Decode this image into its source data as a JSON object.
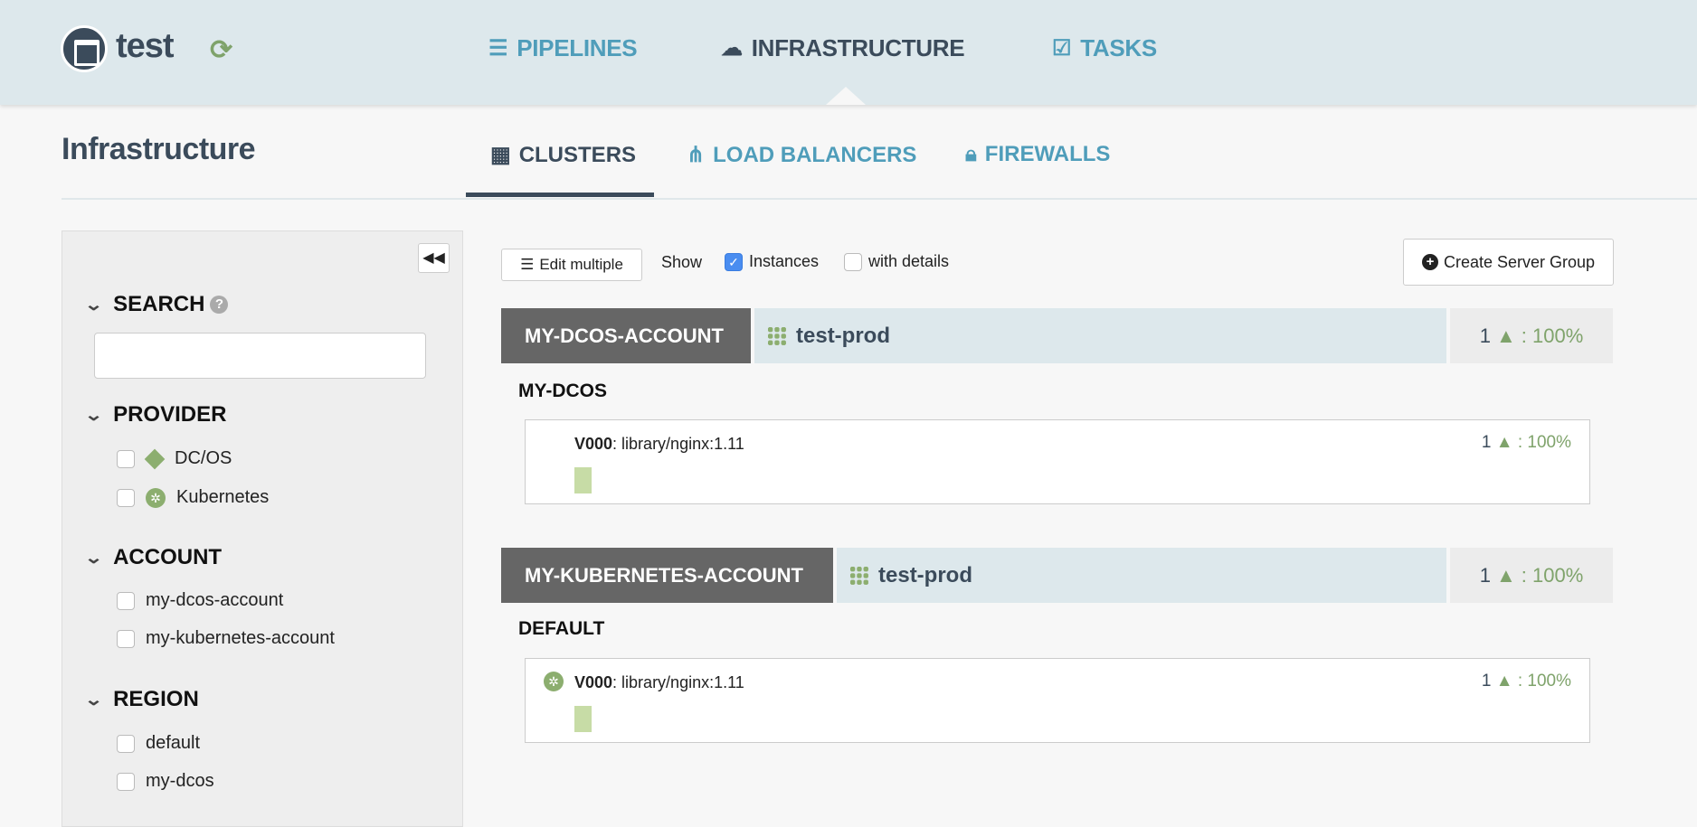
{
  "header": {
    "app_title": "test",
    "nav": [
      {
        "label": "PIPELINES",
        "icon": "list-icon",
        "active": false
      },
      {
        "label": "INFRASTRUCTURE",
        "icon": "cloud-icon",
        "active": true
      },
      {
        "label": "TASKS",
        "icon": "check-square-icon",
        "active": false
      }
    ]
  },
  "page": {
    "title": "Infrastructure",
    "tabs": [
      {
        "label": "CLUSTERS",
        "icon": "th-large-icon",
        "active": true
      },
      {
        "label": "LOAD BALANCERS",
        "icon": "sitemap-icon",
        "active": false
      },
      {
        "label": "FIREWALLS",
        "icon": "lock-icon",
        "active": false
      }
    ]
  },
  "sidebar": {
    "search": {
      "label": "SEARCH",
      "value": "",
      "placeholder": ""
    },
    "provider": {
      "label": "PROVIDER",
      "items": [
        "DC/OS",
        "Kubernetes"
      ]
    },
    "account": {
      "label": "ACCOUNT",
      "items": [
        "my-dcos-account",
        "my-kubernetes-account"
      ]
    },
    "region": {
      "label": "REGION",
      "items": [
        "default",
        "my-dcos"
      ]
    }
  },
  "toolbar": {
    "edit_multiple": "Edit multiple",
    "show": "Show",
    "instances": "Instances",
    "instances_checked": true,
    "with_details": "with details",
    "with_details_checked": false,
    "create": "Create Server Group"
  },
  "clusters": [
    {
      "account": "MY-DCOS-ACCOUNT",
      "name": "test-prod",
      "count": "1",
      "health": ": 100%",
      "region": "MY-DCOS",
      "server_group": {
        "version": "V000",
        "image": ": library/nginx:1.11",
        "count": "1",
        "health": ": 100%",
        "provider": "dcos"
      }
    },
    {
      "account": "MY-KUBERNETES-ACCOUNT",
      "name": "test-prod",
      "count": "1",
      "health": ": 100%",
      "region": "DEFAULT",
      "server_group": {
        "version": "V000",
        "image": ": library/nginx:1.11",
        "count": "1",
        "health": ": 100%",
        "provider": "kubernetes"
      }
    }
  ],
  "colors": {
    "header_bg": "#dde8ec",
    "dark": "#3b4b5b",
    "link": "#4f9dba",
    "healthy": "#7fa36b",
    "account_bg": "#666666"
  }
}
